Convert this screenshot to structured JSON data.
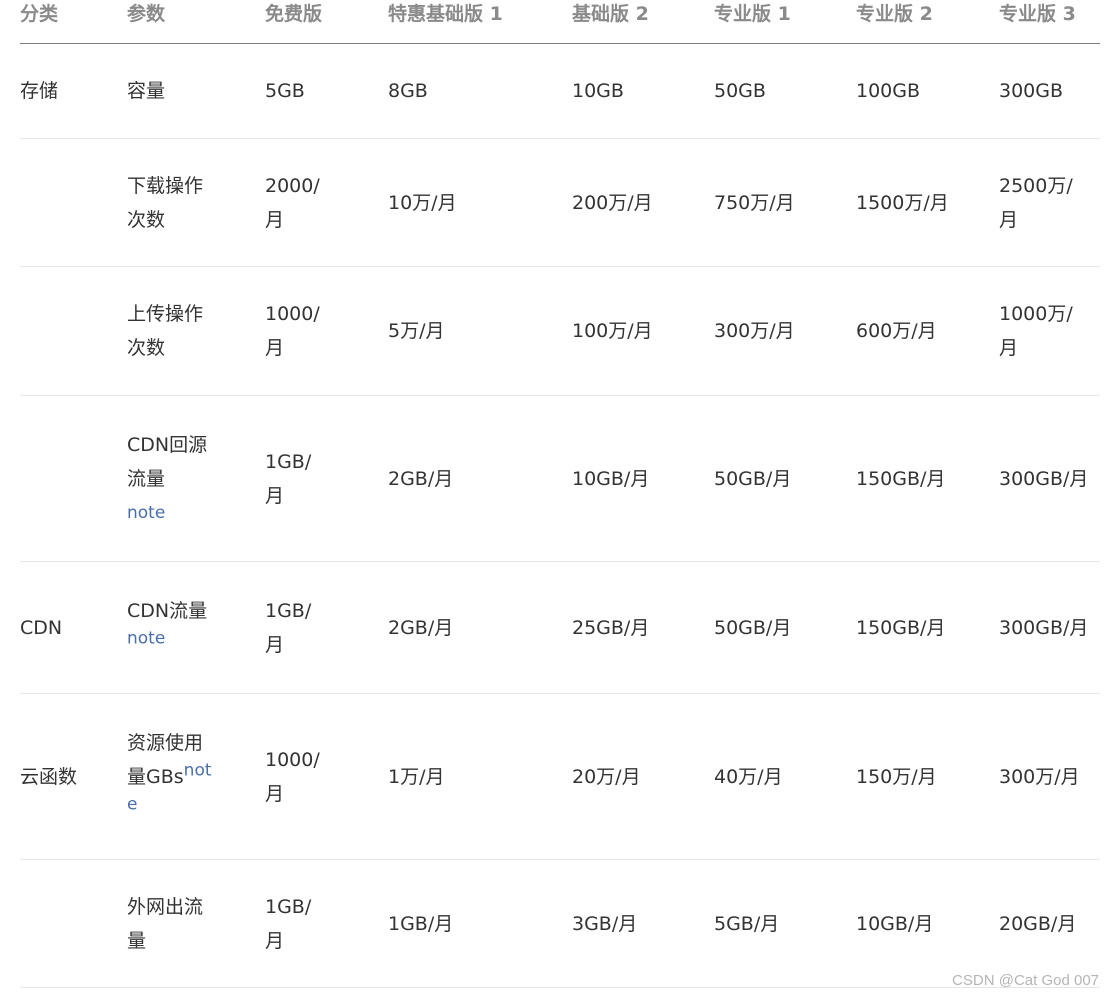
{
  "headers": [
    "分类",
    "参数",
    "免费版",
    "特惠基础版 1",
    "基础版 2",
    "专业版 1",
    "专业版 2",
    "专业版 3"
  ],
  "rows": [
    {
      "category": "存储",
      "param": "容量",
      "note": "",
      "values": [
        "5GB",
        "8GB",
        "10GB",
        "50GB",
        "100GB",
        "300GB"
      ]
    },
    {
      "category": "",
      "param": "下载操作次数",
      "note": "",
      "values": [
        "2000/月",
        "10万/月",
        "200万/月",
        "750万/月",
        "1500万/月",
        "2500万/月"
      ]
    },
    {
      "category": "",
      "param": "上传操作次数",
      "note": "",
      "values": [
        "1000/月",
        "5万/月",
        "100万/月",
        "300万/月",
        "600万/月",
        "1000万/月"
      ]
    },
    {
      "category": "",
      "param": "CDN回源流量",
      "note": "note",
      "values": [
        "1GB/月",
        "2GB/月",
        "10GB/月",
        "50GB/月",
        "150GB/月",
        "300GB/月"
      ]
    },
    {
      "category": "CDN",
      "param": "CDN流量",
      "note": "note",
      "values": [
        "1GB/月",
        "2GB/月",
        "25GB/月",
        "50GB/月",
        "150GB/月",
        "300GB/月"
      ]
    },
    {
      "category": "云函数",
      "param": "资源使用量GBs",
      "note": "note",
      "values": [
        "1000/月",
        "1万/月",
        "20万/月",
        "40万/月",
        "150万/月",
        "300万/月"
      ]
    },
    {
      "category": "",
      "param": "外网出流量",
      "note": "",
      "values": [
        "1GB/月",
        "1GB/月",
        "3GB/月",
        "5GB/月",
        "10GB/月",
        "20GB/月"
      ]
    }
  ],
  "watermark": "CSDN @Cat God 007"
}
